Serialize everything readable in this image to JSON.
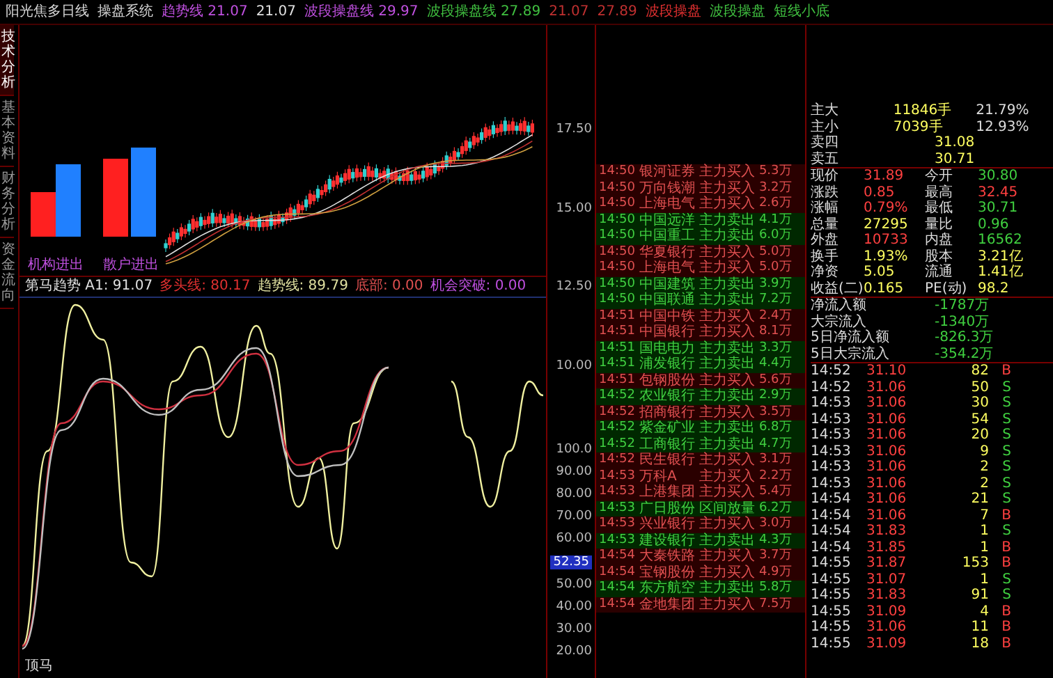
{
  "top_bar": [
    {
      "text": "阳光焦多日线",
      "color": "#d8d8d8"
    },
    {
      "text": "操盘系统",
      "color": "#d8d8d8"
    },
    {
      "text": "趋势线 21.07",
      "color": "#c050e0"
    },
    {
      "text": "21.07",
      "color": "#e0e0e0"
    },
    {
      "text": "波段操盘线 29.97",
      "color": "#c050e0"
    },
    {
      "text": "波段操盘线 27.89",
      "color": "#40c040"
    },
    {
      "text": "21.07",
      "color": "#c03030"
    },
    {
      "text": "27.89",
      "color": "#c03030"
    },
    {
      "text": "波段操盘",
      "color": "#e03030"
    },
    {
      "text": "波段操盘",
      "color": "#40c040"
    },
    {
      "text": "短线小底",
      "color": "#40c040"
    }
  ],
  "side_tabs": [
    {
      "label": "技术分析",
      "selected": true
    },
    {
      "label": "基本资料",
      "selected": false
    },
    {
      "label": "财务分析",
      "selected": false
    },
    {
      "label": "资金流向",
      "selected": false
    }
  ],
  "upper_chart": {
    "bar_labels": [
      "机构进出",
      "散户进出"
    ]
  },
  "indicator_header": [
    {
      "text": "第马趋势 A1: 91.07",
      "kind": "main"
    },
    {
      "text": "多头线: 80.17",
      "kind": "long"
    },
    {
      "text": "趋势线: 89.79",
      "kind": "trend"
    },
    {
      "text": "底部: 0.00",
      "kind": "bottom"
    },
    {
      "text": "机会突破: 0.00",
      "kind": "breakout"
    }
  ],
  "indicator_bottom_label": "顶马",
  "price_axis_upper": [
    "17.50",
    "15.00",
    "12.50",
    "10.00"
  ],
  "price_axis_lower": [
    "100.0",
    "90.00",
    "80.00",
    "70.00",
    "60.00",
    "50.00",
    "40.00",
    "30.00",
    "20.00"
  ],
  "current_value": "52.35",
  "order_flow": [
    {
      "time": "14:50",
      "name": "银河证券",
      "action": "主力买入",
      "amount": "5.3万",
      "kind": "buy"
    },
    {
      "time": "14:50",
      "name": "万向钱潮",
      "action": "主力买入",
      "amount": "3.2万",
      "kind": "buy"
    },
    {
      "time": "14:50",
      "name": "上海电气",
      "action": "主力买入",
      "amount": "2.6万",
      "kind": "buy"
    },
    {
      "time": "14:50",
      "name": "中国远洋",
      "action": "主力卖出",
      "amount": "4.1万",
      "kind": "sell"
    },
    {
      "time": "14:50",
      "name": "中国重工",
      "action": "主力卖出",
      "amount": "6.0万",
      "kind": "sell"
    },
    {
      "time": "14:50",
      "name": "华夏银行",
      "action": "主力买入",
      "amount": "5.0万",
      "kind": "buy"
    },
    {
      "time": "14:50",
      "name": "上海电气",
      "action": "主力买入",
      "amount": "5.0万",
      "kind": "buy"
    },
    {
      "time": "14:50",
      "name": "中国建筑",
      "action": "主力卖出",
      "amount": "3.9万",
      "kind": "sell"
    },
    {
      "time": "14:50",
      "name": "中国联通",
      "action": "主力卖出",
      "amount": "7.2万",
      "kind": "sell"
    },
    {
      "time": "14:51",
      "name": "中国中铁",
      "action": "主力买入",
      "amount": "2.4万",
      "kind": "buy"
    },
    {
      "time": "14:51",
      "name": "中国银行",
      "action": "主力买入",
      "amount": "8.1万",
      "kind": "buy"
    },
    {
      "time": "14:51",
      "name": "国电电力",
      "action": "主力卖出",
      "amount": "3.3万",
      "kind": "sell"
    },
    {
      "time": "14:51",
      "name": "浦发银行",
      "action": "主力卖出",
      "amount": "4.4万",
      "kind": "sell"
    },
    {
      "time": "14:51",
      "name": "包钢股份",
      "action": "主力买入",
      "amount": "5.6万",
      "kind": "buy"
    },
    {
      "time": "14:52",
      "name": "农业银行",
      "action": "主力卖出",
      "amount": "2.9万",
      "kind": "sell"
    },
    {
      "time": "14:52",
      "name": "招商银行",
      "action": "主力买入",
      "amount": "3.5万",
      "kind": "buy"
    },
    {
      "time": "14:52",
      "name": "紫金矿业",
      "action": "主力卖出",
      "amount": "6.8万",
      "kind": "sell"
    },
    {
      "time": "14:52",
      "name": "工商银行",
      "action": "主力卖出",
      "amount": "4.7万",
      "kind": "sell"
    },
    {
      "time": "14:52",
      "name": "民生银行",
      "action": "主力买入",
      "amount": "3.1万",
      "kind": "buy"
    },
    {
      "time": "14:53",
      "name": "万科A",
      "action": "主力买入",
      "amount": "2.2万",
      "kind": "buy"
    },
    {
      "time": "14:53",
      "name": "上港集团",
      "action": "主力买入",
      "amount": "5.4万",
      "kind": "buy"
    },
    {
      "time": "14:53",
      "name": "广日股份",
      "action": "区间放量",
      "amount": "6.2万",
      "kind": "sell"
    },
    {
      "time": "14:53",
      "name": "兴业银行",
      "action": "主力买入",
      "amount": "3.0万",
      "kind": "buy"
    },
    {
      "time": "14:53",
      "name": "建设银行",
      "action": "主力卖出",
      "amount": "4.3万",
      "kind": "sell"
    },
    {
      "time": "14:54",
      "name": "大秦铁路",
      "action": "主力买入",
      "amount": "3.7万",
      "kind": "buy"
    },
    {
      "time": "14:54",
      "name": "宝钢股份",
      "action": "主力买入",
      "amount": "4.9万",
      "kind": "buy"
    },
    {
      "time": "14:54",
      "name": "东方航空",
      "action": "主力卖出",
      "amount": "5.8万",
      "kind": "sell"
    },
    {
      "time": "14:54",
      "name": "金地集团",
      "action": "主力买入",
      "amount": "7.5万",
      "kind": "buy"
    }
  ],
  "volume_summary": [
    {
      "label": "主大",
      "value": "11846手",
      "pct": "21.79%"
    },
    {
      "label": "主小",
      "value": "7039手",
      "pct": "12.93%"
    }
  ],
  "asks": [
    {
      "label": "卖四",
      "price": "31.08"
    },
    {
      "label": "卖五",
      "price": "30.71"
    }
  ],
  "quote": [
    {
      "label": "现价",
      "value": "31.89",
      "kind": "up"
    },
    {
      "label": "今开",
      "value": "30.80",
      "kind": "down"
    },
    {
      "label": "涨跌",
      "value": "0.85",
      "kind": "up"
    },
    {
      "label": "最高",
      "value": "32.45",
      "kind": "up"
    },
    {
      "label": "涨幅",
      "value": "0.79%",
      "kind": "up"
    },
    {
      "label": "最低",
      "value": "30.71",
      "kind": "down"
    },
    {
      "label": "总量",
      "value": "27295",
      "kind": "neutral"
    },
    {
      "label": "量比",
      "value": "0.96",
      "kind": "down"
    },
    {
      "label": "外盘",
      "value": "10733",
      "kind": "up"
    },
    {
      "label": "内盘",
      "value": "16562",
      "kind": "down"
    },
    {
      "label": "换手",
      "value": "1.93%",
      "kind": "neutral"
    },
    {
      "label": "股本",
      "value": "3.21亿",
      "kind": "neutral"
    },
    {
      "label": "净资",
      "value": "5.05",
      "kind": "neutral"
    },
    {
      "label": "流通",
      "value": "1.41亿",
      "kind": "neutral"
    },
    {
      "label": "收益(二)",
      "value": "0.165",
      "kind": "neutral"
    },
    {
      "label": "PE(动)",
      "value": "98.2",
      "kind": "neutral"
    }
  ],
  "flows": [
    {
      "label": "净流入额",
      "value": "-1787万"
    },
    {
      "label": "大宗流入",
      "value": "-1340万"
    },
    {
      "label": "5日净流入额",
      "value": "-826.3万"
    },
    {
      "label": "5日大宗流入",
      "value": "-354.2万"
    }
  ],
  "ticks": [
    {
      "time": "14:52",
      "price": "31.10",
      "volume": "82",
      "side": "B"
    },
    {
      "time": "14:52",
      "price": "31.06",
      "volume": "50",
      "side": "S"
    },
    {
      "time": "14:53",
      "price": "31.06",
      "volume": "30",
      "side": "S"
    },
    {
      "time": "14:53",
      "price": "31.06",
      "volume": "54",
      "side": "S"
    },
    {
      "time": "14:53",
      "price": "31.06",
      "volume": "20",
      "side": "S"
    },
    {
      "time": "14:53",
      "price": "31.06",
      "volume": "9",
      "side": "S"
    },
    {
      "time": "14:53",
      "price": "31.06",
      "volume": "2",
      "side": "S"
    },
    {
      "time": "14:53",
      "price": "31.06",
      "volume": "2",
      "side": "S"
    },
    {
      "time": "14:54",
      "price": "31.06",
      "volume": "21",
      "side": "S"
    },
    {
      "time": "14:54",
      "price": "31.06",
      "volume": "7",
      "side": "B"
    },
    {
      "time": "14:54",
      "price": "31.83",
      "volume": "1",
      "side": "S"
    },
    {
      "time": "14:54",
      "price": "31.85",
      "volume": "1",
      "side": "B"
    },
    {
      "time": "14:55",
      "price": "31.87",
      "volume": "153",
      "side": "B"
    },
    {
      "time": "14:55",
      "price": "31.07",
      "volume": "1",
      "side": "S"
    },
    {
      "time": "14:55",
      "price": "31.83",
      "volume": "91",
      "side": "S"
    },
    {
      "time": "14:55",
      "price": "31.09",
      "volume": "4",
      "side": "B"
    },
    {
      "time": "14:55",
      "price": "31.06",
      "volume": "11",
      "side": "B"
    },
    {
      "time": "14:55",
      "price": "31.09",
      "volume": "18",
      "side": "B"
    }
  ]
}
